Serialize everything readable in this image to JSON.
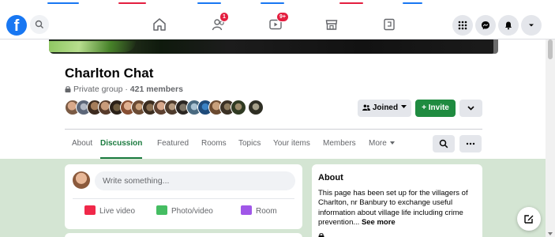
{
  "colors": {
    "brand": "#1877f2",
    "accent_green": "#1a7a3e",
    "invite_green": "#1f8b40",
    "badge_red": "#e41e3f",
    "content_bg": "#d4e5d3"
  },
  "navbar": {
    "icons": [
      "facebook-logo",
      "search-icon",
      "home-icon",
      "friends-icon",
      "watch-icon",
      "marketplace-icon",
      "gaming-icon",
      "menu-grid-icon",
      "messenger-icon",
      "notifications-icon",
      "account-caret-icon"
    ],
    "friends_badge": "1",
    "watch_badge": "9+"
  },
  "group": {
    "title": "Charlton Chat",
    "privacy": "Private group",
    "separator": "·",
    "members": "421 members",
    "joined_label": "Joined",
    "invite_label": "+ Invite"
  },
  "tabs": [
    {
      "label": "About",
      "active": false
    },
    {
      "label": "Discussion",
      "active": true
    },
    {
      "label": "Featured",
      "active": false
    },
    {
      "label": "Rooms",
      "active": false
    },
    {
      "label": "Topics",
      "active": false
    },
    {
      "label": "Your items",
      "active": false
    },
    {
      "label": "Members",
      "active": false
    },
    {
      "label": "More",
      "active": false
    }
  ],
  "composer": {
    "placeholder": "Write something...",
    "actions": [
      {
        "label": "Live video",
        "icon": "live-video-icon"
      },
      {
        "label": "Photo/video",
        "icon": "photo-video-icon"
      },
      {
        "label": "Room",
        "icon": "room-icon"
      }
    ]
  },
  "about": {
    "title": "About",
    "description": "This page has been set up for the villagers of Charlton, nr Banbury to exchange useful information about village life including crime prevention...",
    "see_more": "See more"
  }
}
